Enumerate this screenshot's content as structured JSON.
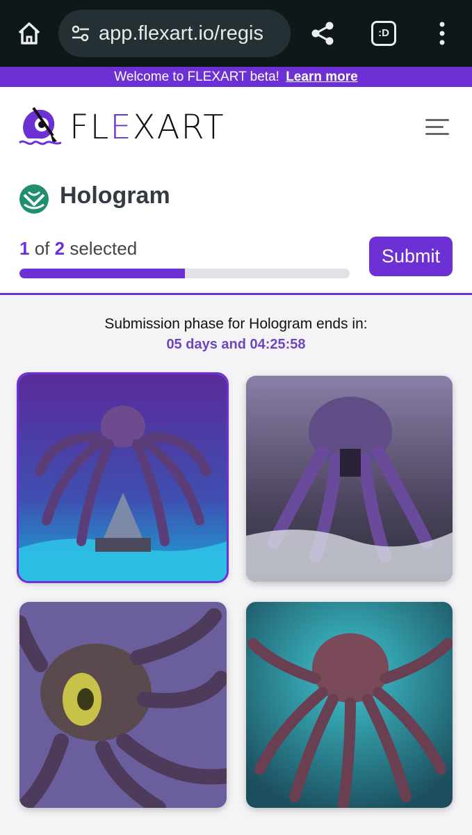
{
  "browser": {
    "url": "app.flexart.io/regis",
    "tab_icon_label": ":D"
  },
  "banner": {
    "text": "Welcome to FLEXART beta!",
    "link": "Learn more"
  },
  "header": {
    "brand_left": "FL",
    "brand_e": "E",
    "brand_right": "XART"
  },
  "contest": {
    "title": "Hologram",
    "selected_count": "1",
    "of_word": "of",
    "total_count": "2",
    "selected_word": "selected",
    "progress_fraction": 0.5,
    "submit_label": "Submit"
  },
  "countdown": {
    "label": "Submission phase for Hologram ends in:",
    "value": "05 days and 04:25:58"
  },
  "artworks": [
    {
      "selected": true
    },
    {
      "selected": false
    },
    {
      "selected": false
    },
    {
      "selected": false
    }
  ],
  "colors": {
    "accent": "#6d30d5",
    "countdown": "#6c46c0",
    "browser_bg": "#0f1719"
  }
}
